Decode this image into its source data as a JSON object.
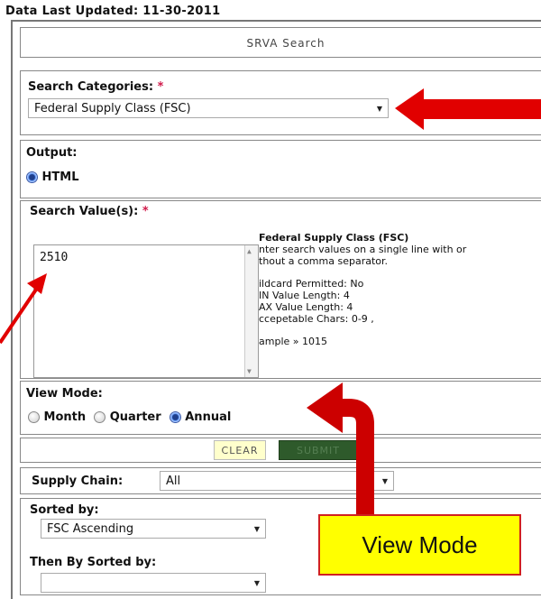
{
  "last_updated": "Data Last Updated: 11-30-2011",
  "title": "SRVA Search",
  "search_categories": {
    "label": "Search Categories:",
    "required_mark": "*",
    "selected": "Federal Supply Class (FSC)"
  },
  "output": {
    "label": "Output:",
    "option": "HTML"
  },
  "search_values": {
    "label": "Search Value(s):",
    "required_mark": "*",
    "value": "2510",
    "help": {
      "title": "Federal Supply Class (FSC)",
      "line1": "nter search values on a single line with or",
      "line2": "thout a comma separator.",
      "line3": "ildcard Permitted: No",
      "line4": "IN Value Length: 4",
      "line5": "AX Value Length: 4",
      "line6": "ccepetable Chars: 0-9 ,",
      "line7": "ample » 1015"
    }
  },
  "view_mode": {
    "label": "View Mode:",
    "options": [
      "Month",
      "Quarter",
      "Annual"
    ],
    "selected": "Annual"
  },
  "buttons": {
    "clear": "CLEAR",
    "submit": "SUBMIT"
  },
  "supply_chain": {
    "label": "Supply Chain:",
    "selected": "All"
  },
  "sorted_by": {
    "label": "Sorted by:",
    "selected": "FSC Ascending"
  },
  "then_by": {
    "label": "Then By Sorted by:",
    "selected": ""
  },
  "callout_text": "View Mode",
  "colors": {
    "arrow": "#e10000",
    "required": "#d01a4a",
    "callout_bg": "#ffff00",
    "radio_selected": "#2b5bd1",
    "submit_bg": "#2e5a2b",
    "clear_bg": "#ffffcc"
  }
}
